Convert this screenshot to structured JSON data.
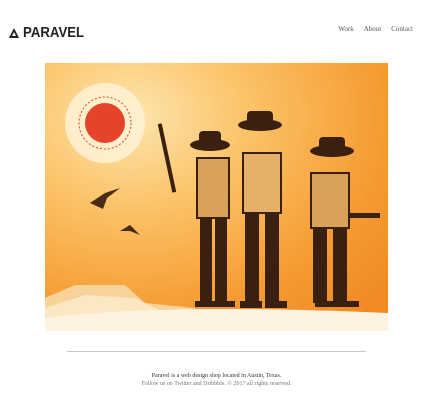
{
  "header": {
    "brand": "PARAVEL",
    "nav": [
      {
        "label": "Work"
      },
      {
        "label": "About"
      },
      {
        "label": "Contact"
      }
    ]
  },
  "hero": {
    "icon": "cowboys-illustration",
    "colors": {
      "orange": "#f08a24",
      "light_orange": "#f8b04a",
      "sun_red": "#e5432a",
      "ink": "#3a2010",
      "tan": "#d9a25b"
    }
  },
  "footer": {
    "line1": "Paravel is a web design shop located in Austin, Texas.",
    "prefix": "Follow us on",
    "twitter": "Twitter",
    "and": "and",
    "dribbble": "Dribbble",
    "suffix": ". © 2017 all rights reserved."
  }
}
